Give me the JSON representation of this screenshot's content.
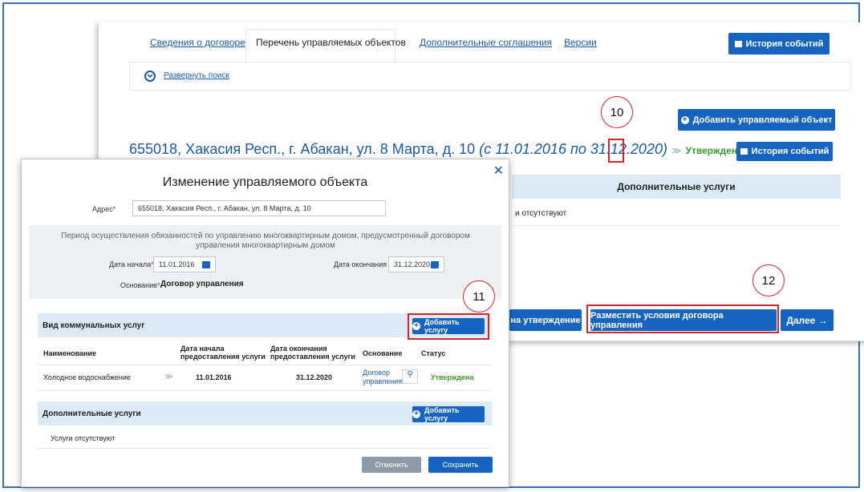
{
  "tabs": {
    "contract_info": "Сведения о договоре",
    "objects_list": "Перечень управляемых объектов",
    "extra_agreements": "Дополнительные соглашения",
    "versions": "Версии"
  },
  "history_button": "История событий",
  "expand_search": "Развернуть поиск",
  "add_object_button": "Добавить управляемый объект",
  "object": {
    "address": "655018, Хакасия Респ., г. Абакан, ул. 8 Марта, д. 10",
    "period": "(с 11.01.2016 по 31.12.2020)",
    "status": "Утвержден"
  },
  "right_panel": {
    "extra_services_header": "Дополнительные услуги",
    "extra_services_empty": "и отсутствуют",
    "submit_approval": "на утверждение",
    "publish_terms": "Разместить условия договора управления",
    "next": "Далее →"
  },
  "callouts": {
    "c10": "10",
    "c11": "11",
    "c12": "12"
  },
  "modal": {
    "title": "Изменение управляемого объекта",
    "address_label": "Адрес",
    "address_value": "655018, Хакасия Респ., г. Абакан, ул. 8 Марта, д. 10",
    "period_text": "Период осуществления обязанностей по управлению многоквартирным домом, предусмотренный договором управления многоквартирным домом",
    "start_label": "Дата начала",
    "start_value": "11.01.2016",
    "end_label": "Дата окончания",
    "end_value": "31.12.2020",
    "basis_label": "Основание",
    "basis_value": "Договор управления",
    "utilities_header": "Вид коммунальных услуг",
    "add_service": "Добавить услугу",
    "columns": {
      "name": "Наименование",
      "start": "Дата начала предоставления услуги",
      "end": "Дата окончания предоставления услуги",
      "basis": "Основание",
      "status": "Статус"
    },
    "row": {
      "name": "Холодное водоснабжение",
      "start": "11.01.2016",
      "end": "31.12.2020",
      "basis": "Договор управления",
      "status": "Утверждена"
    },
    "extra_header": "Дополнительные услуги",
    "extra_empty": "Услуги отсутствуют",
    "cancel": "Отменить",
    "save": "Сохранить"
  },
  "colors": {
    "accent": "#1565c0",
    "link": "#1a5aa3",
    "success": "#3a9a2a",
    "highlight": "#d9232a",
    "section": "#dceaf6"
  }
}
